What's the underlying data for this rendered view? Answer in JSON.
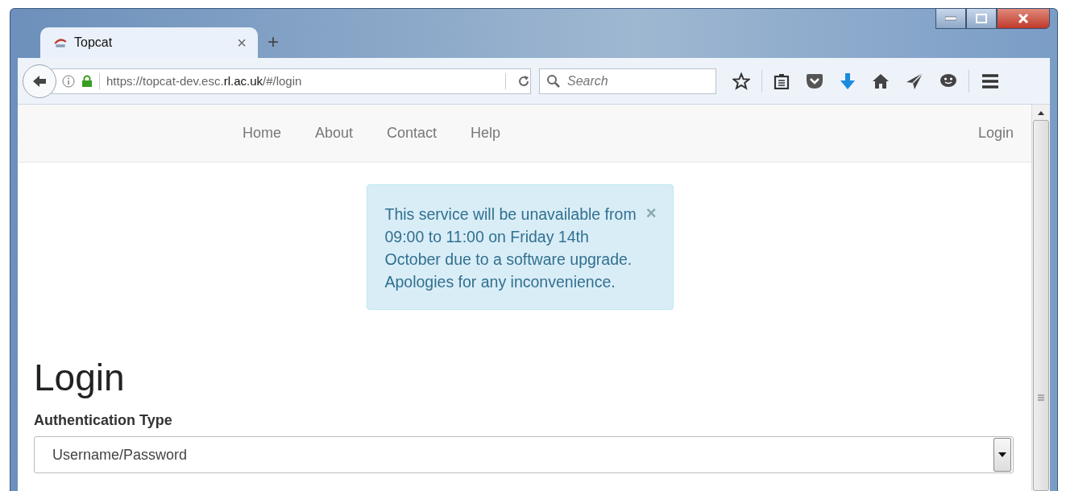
{
  "browser": {
    "tabs": [
      {
        "title": "Topcat",
        "close": "×",
        "selected": true
      }
    ],
    "new_tab": "+",
    "url": "https://topcat-dev.esc.**rl.ac.uk**/#/login",
    "search": {
      "placeholder": "Search"
    }
  },
  "navbar": {
    "links": [
      {
        "label": "Home"
      },
      {
        "label": "About"
      },
      {
        "label": "Contact"
      },
      {
        "label": "Help"
      }
    ],
    "right_link": "Login"
  },
  "alert": {
    "message": "This service will be unavailable from 09:00 to 11:00 on Friday 14th October due to a software upgrade. Apologies for any inconvenience.",
    "close": "×"
  },
  "page": {
    "heading": "Login",
    "field_label": "Authentication Type",
    "select_value": "Username/Password"
  }
}
